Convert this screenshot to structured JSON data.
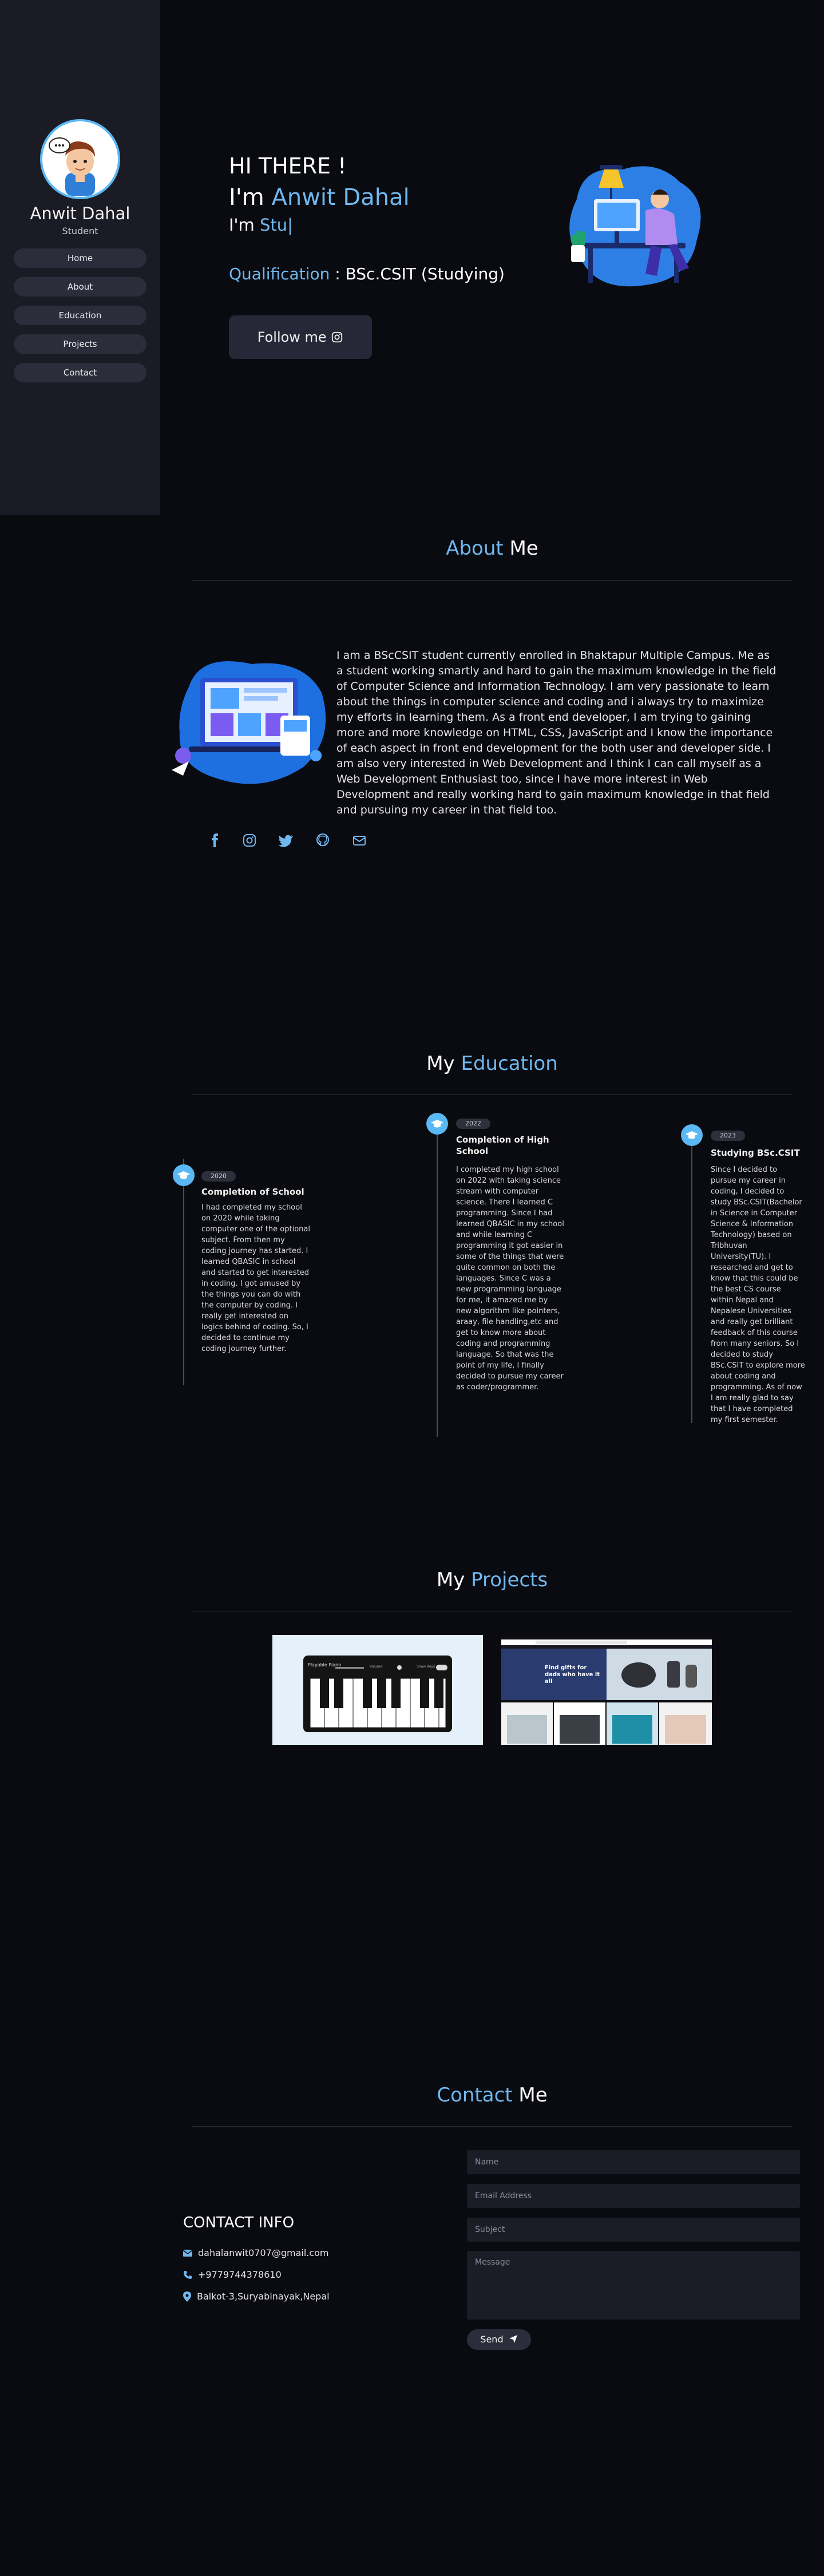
{
  "sidebar": {
    "name": "Anwit Dahal",
    "role": "Student",
    "nav": [
      {
        "label": "Home"
      },
      {
        "label": "About"
      },
      {
        "label": "Education"
      },
      {
        "label": "Projects"
      },
      {
        "label": "Contact"
      }
    ]
  },
  "hero": {
    "greeting": "HI THERE !",
    "im_prefix": "I'm ",
    "name": "Anwit Dahal",
    "typing_prefix": "I'm ",
    "typing_text": "Stu|",
    "qualification_label": "Qualification",
    "qualification_value": " : BSc.CSIT (Studying)",
    "follow_label": "Follow me",
    "follow_icon": "instagram-icon"
  },
  "about": {
    "title_accent": "About",
    "title_rest": " Me",
    "text": "I am a BScCSIT student currently enrolled in Bhaktapur Multiple Campus. Me as a student working smartly and hard to gain the maximum knowledge in the field of Computer Science and Information Technology. I am very passionate to learn about the things in computer science and coding and i always try to maximize my efforts in learning them. As a front end developer, I am trying to gaining more and more knowledge on HTML, CSS, JavaScript and I know the importance of each aspect in front end development for the both user and developer side. I am also very interested in Web Development and I think I can call myself as a Web Development Enthusiast too, since I have more interest in Web Development and really working hard to gain maximum knowledge in that field and pursuing my career in that field too.",
    "socials": [
      "facebook-icon",
      "instagram-icon",
      "twitter-icon",
      "github-icon",
      "mail-icon"
    ]
  },
  "education": {
    "title_rest": "My ",
    "title_accent": "Education",
    "items": [
      {
        "year": "2020",
        "title": "Completion of School",
        "desc": "I had completed my school on 2020 while taking computer one of the optional subject. From then my coding journey has started. I learned QBASIC in school and started to get interested in coding. I got amused by the things you can do with the computer by coding. I really get interested on logics behind of coding. So, I decided to continue my coding journey further."
      },
      {
        "year": "2022",
        "title": "Completion of High School",
        "desc": "I completed my high school on 2022 with taking science stream with computer science. There I learned C programming. Since I had learned QBASIC in my school and while learning C programming it got easier in some of the things that were quite common on both the languages. Since C was a new programming language for me, it amazed me by new algorithm like pointers, araay, file handling,etc and get to know more about coding and programming language. So that was the point of my life, I finally decided to pursue my career as coder/programmer."
      },
      {
        "year": "2023",
        "title": "Studying BSc.CSIT",
        "desc": "Since I decided to pursue my career in coding, I decided to study BSc.CSIT(Bachelor in Science in Computer Science & Information Technology) based on Tribhuvan University(TU). I researched and get to know that this could be the best CS course within Nepal and Nepalese Universities and really get brilliant feedback of this course from many seniors. So I decided to study BSc.CSIT to explore more about coding and programming. As of now I am really glad to say that I have completed my first semester."
      }
    ]
  },
  "projects": {
    "title_rest": "My ",
    "title_accent": "Projects",
    "piano_title": "Playable Piano",
    "piano_volume": "Volume",
    "piano_keys": "Show Keys",
    "shop_banner": "Find gifts for dads who have it all"
  },
  "contact": {
    "title_accent": "Contact",
    "title_rest": " Me",
    "heading": "CONTACT INFO",
    "email": "dahalanwit0707@gmail.com",
    "phone": "+9779744378610",
    "address": "Balkot-3,Suryabinayak,Nepal",
    "form": {
      "name_placeholder": "Name",
      "email_placeholder": "Email Address",
      "subject_placeholder": "Subject",
      "message_placeholder": "Message",
      "send_label": "Send"
    }
  },
  "colors": {
    "accent": "#6fb8f0",
    "sidebar_bg": "#1a1b24",
    "page_bg": "#0a0b10"
  }
}
